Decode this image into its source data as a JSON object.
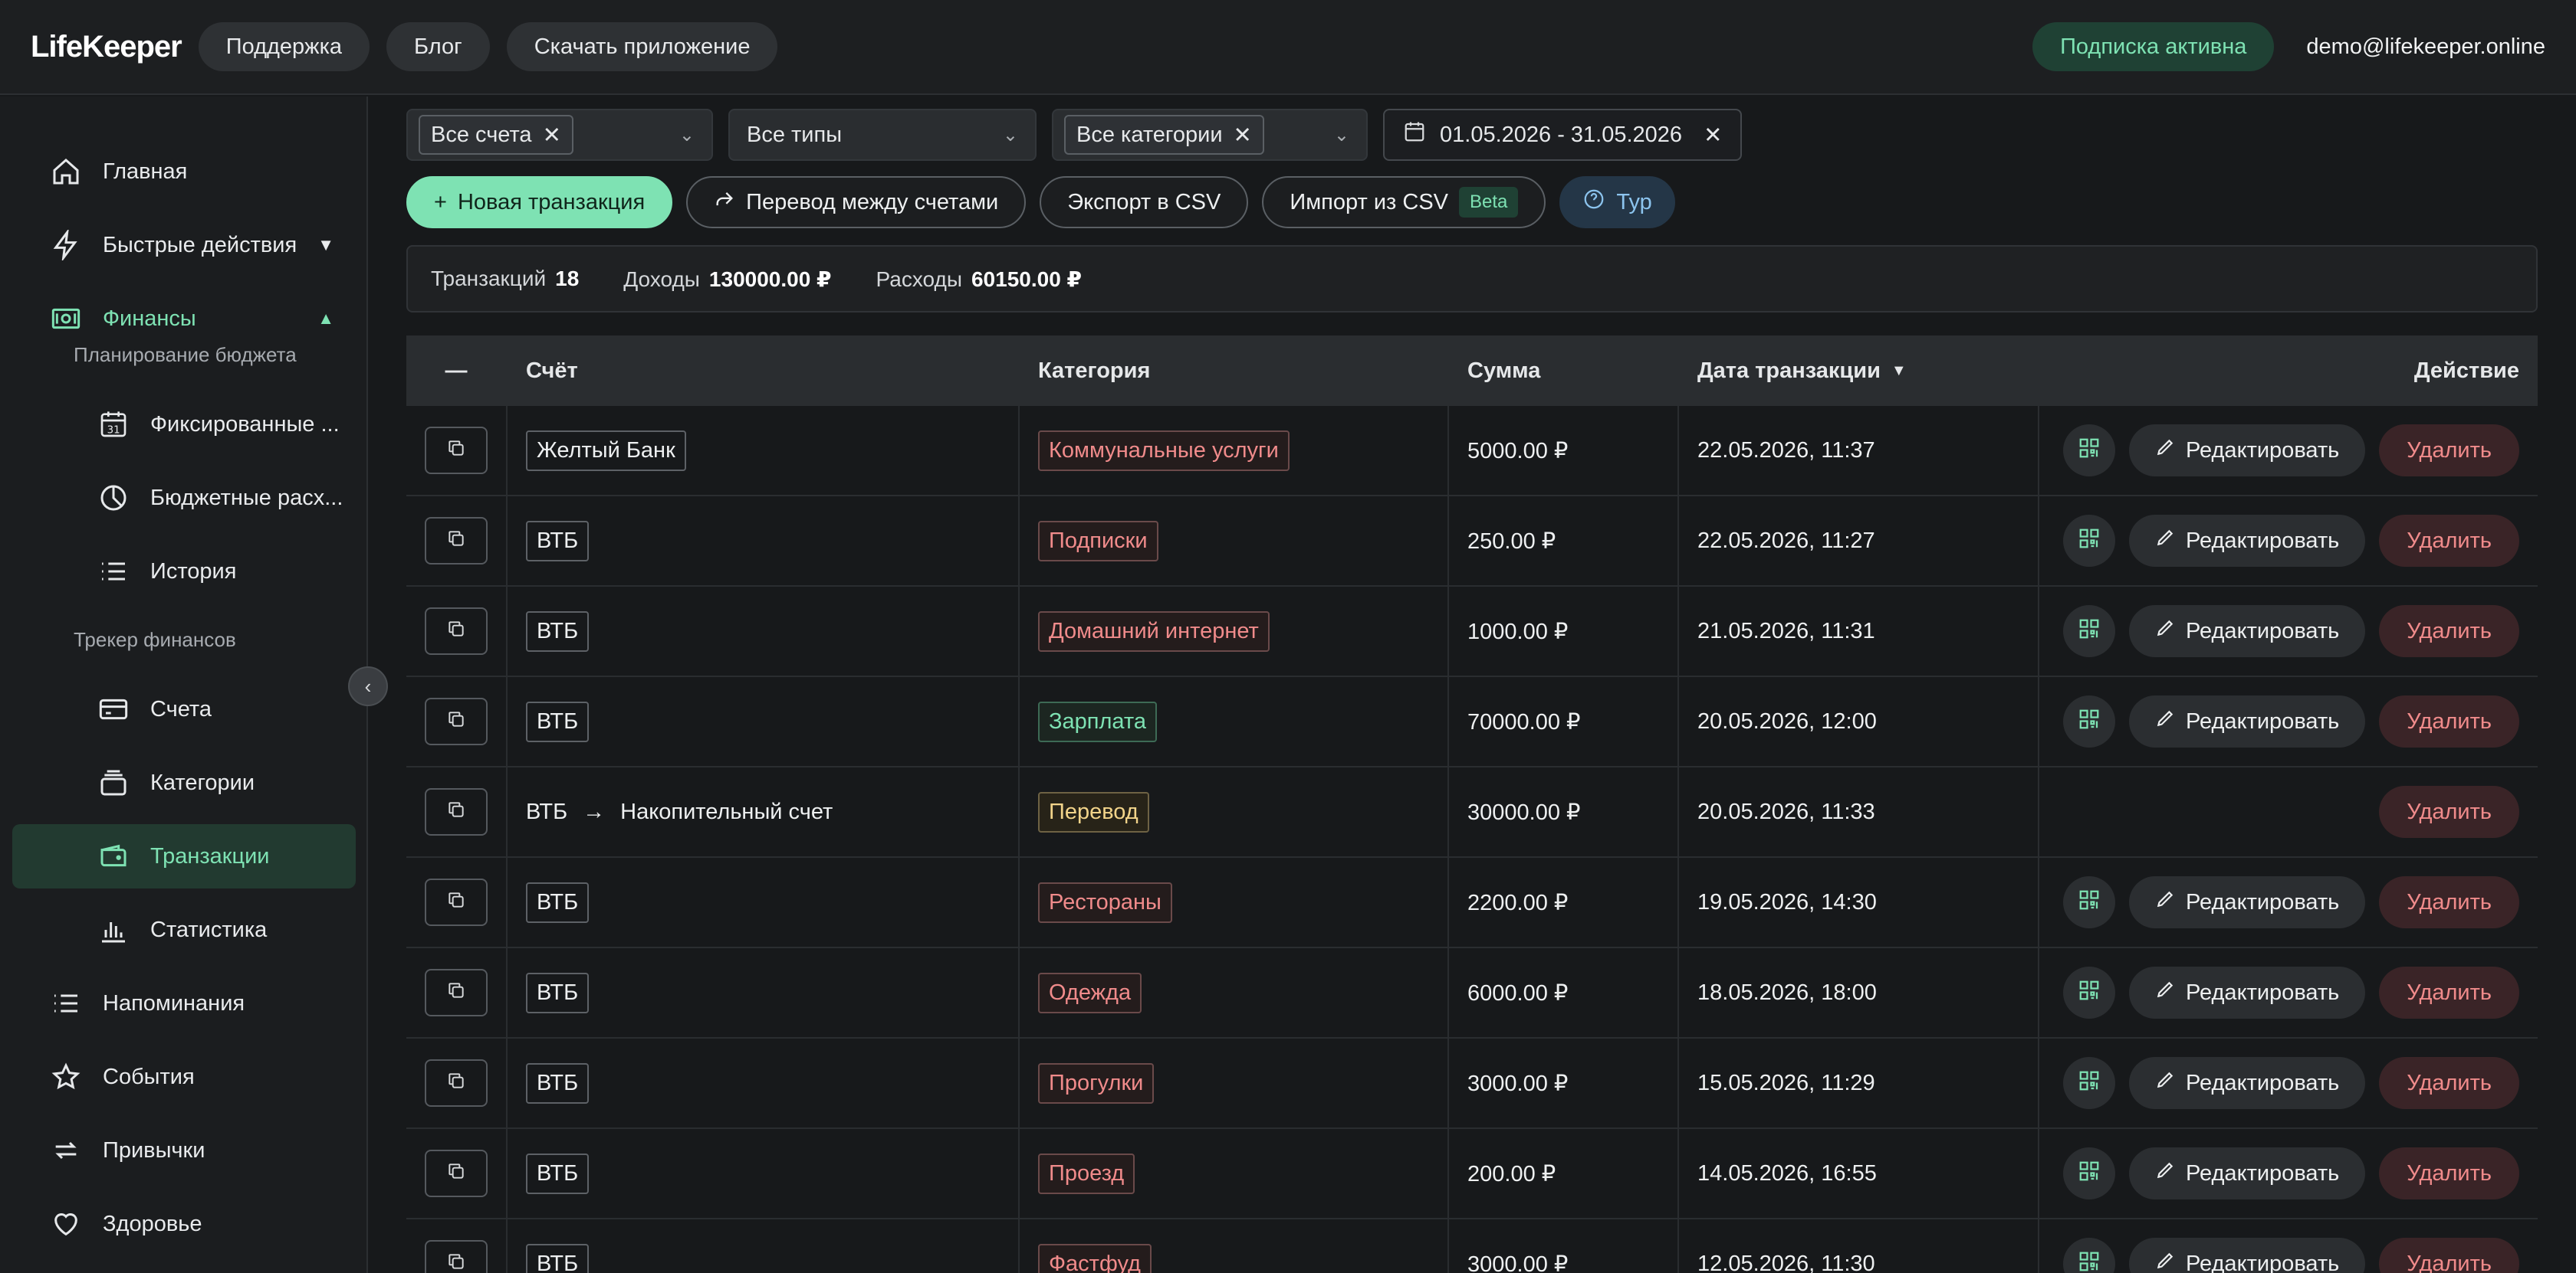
{
  "header": {
    "logo": "LifeKeeper",
    "nav": [
      "Поддержка",
      "Блог",
      "Скачать приложение"
    ],
    "subscription": "Подписка активна",
    "email": "demo@lifekeeper.online"
  },
  "sidebar": {
    "home": "Главная",
    "quick_actions": "Быстрые действия",
    "finance": "Финансы",
    "budget_section": "Планирование бюджета",
    "fixed": "Фиксированные ...",
    "budget_expenses": "Бюджетные расх...",
    "history": "История",
    "tracker_section": "Трекер финансов",
    "accounts": "Счета",
    "categories": "Категории",
    "transactions": "Транзакции",
    "statistics": "Статистика",
    "reminders": "Напоминания",
    "events": "События",
    "habits": "Привычки",
    "health": "Здоровье"
  },
  "filters": {
    "accounts": "Все счета",
    "types": "Все типы",
    "categories": "Все категории",
    "date_range": "01.05.2026 - 31.05.2026"
  },
  "toolbar": {
    "new_transaction": "Новая транзакция",
    "transfer": "Перевод между счетами",
    "export": "Экспорт в CSV",
    "import": "Импорт из CSV",
    "beta": "Beta",
    "tour": "Тур"
  },
  "summary": {
    "count_label": "Транзакций",
    "count": "18",
    "income_label": "Доходы",
    "income": "130000.00 ₽",
    "expense_label": "Расходы",
    "expense": "60150.00 ₽"
  },
  "table": {
    "select_all": "—",
    "headers": {
      "account": "Счёт",
      "category": "Категория",
      "amount": "Сумма",
      "date": "Дата транзакции",
      "action": "Действие"
    },
    "edit_label": "Редактировать",
    "delete_label": "Удалить",
    "rows": [
      {
        "account": "Желтый Банк",
        "category": "Коммунальные услуги",
        "amount": "5000.00 ₽",
        "date": "22.05.2026, 11:37"
      },
      {
        "account": "ВТБ",
        "category": "Подписки",
        "amount": "250.00 ₽",
        "date": "22.05.2026, 11:27"
      },
      {
        "account": "ВТБ",
        "category": "Домашний интернет",
        "amount": "1000.00 ₽",
        "date": "21.05.2026, 11:31"
      },
      {
        "account": "ВТБ",
        "category": "Зарплата",
        "amount": "70000.00 ₽",
        "date": "20.05.2026, 12:00"
      },
      {
        "account_from": "ВТБ",
        "account_to": "Накопительный счет",
        "category": "Перевод",
        "amount": "30000.00 ₽",
        "date": "20.05.2026, 11:33"
      },
      {
        "account": "ВТБ",
        "category": "Рестораны",
        "amount": "2200.00 ₽",
        "date": "19.05.2026, 14:30"
      },
      {
        "account": "ВТБ",
        "category": "Одежда",
        "amount": "6000.00 ₽",
        "date": "18.05.2026, 18:00"
      },
      {
        "account": "ВТБ",
        "category": "Прогулки",
        "amount": "3000.00 ₽",
        "date": "15.05.2026, 11:29"
      },
      {
        "account": "ВТБ",
        "category": "Проезд",
        "amount": "200.00 ₽",
        "date": "14.05.2026, 16:55"
      },
      {
        "account": "ВТБ",
        "category": "Фастфуд",
        "amount": "3000.00 ₽",
        "date": "12.05.2026, 11:30"
      }
    ]
  },
  "colors": {
    "accent": "#7ee2b3",
    "expense": "#f08b8b",
    "transfer": "#f2d48a",
    "background": "#17191b"
  }
}
